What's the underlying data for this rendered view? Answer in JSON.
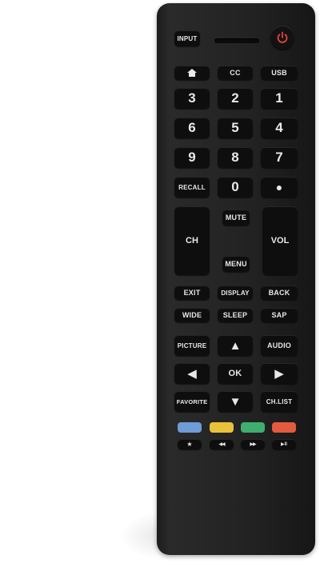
{
  "remote": {
    "top_row": {
      "input": "INPUT"
    },
    "row1": {
      "home_icon": "home-icon",
      "cc": "CC",
      "usb": "USB"
    },
    "digits": [
      "1",
      "2",
      "3",
      "4",
      "5",
      "6",
      "7",
      "8",
      "9",
      "0"
    ],
    "recall": "RECALL",
    "dot": "●",
    "ch": "CH",
    "vol": "VOL",
    "mute": "MUTE",
    "menu": "MENU",
    "row_a": {
      "exit": "EXIT",
      "display": "DISPLAY",
      "back": "BACK"
    },
    "row_b": {
      "wide": "WIDE",
      "sleep": "SLEEP",
      "sap": "SAP"
    },
    "picture": "PICTURE",
    "audio": "AUDIO",
    "ok": "OK",
    "favorite": "FAVORITE",
    "chlist": "CH.LIST",
    "arrows": {
      "up": "▲",
      "down": "▼",
      "left": "◀",
      "right": "▶"
    },
    "colors": [
      "#6f9bd6",
      "#e8c23a",
      "#3fae6e",
      "#e35a3f"
    ],
    "transport": {
      "star": "★",
      "rew": "◀◀",
      "ff": "▶▶",
      "playpause": "▶II"
    }
  }
}
